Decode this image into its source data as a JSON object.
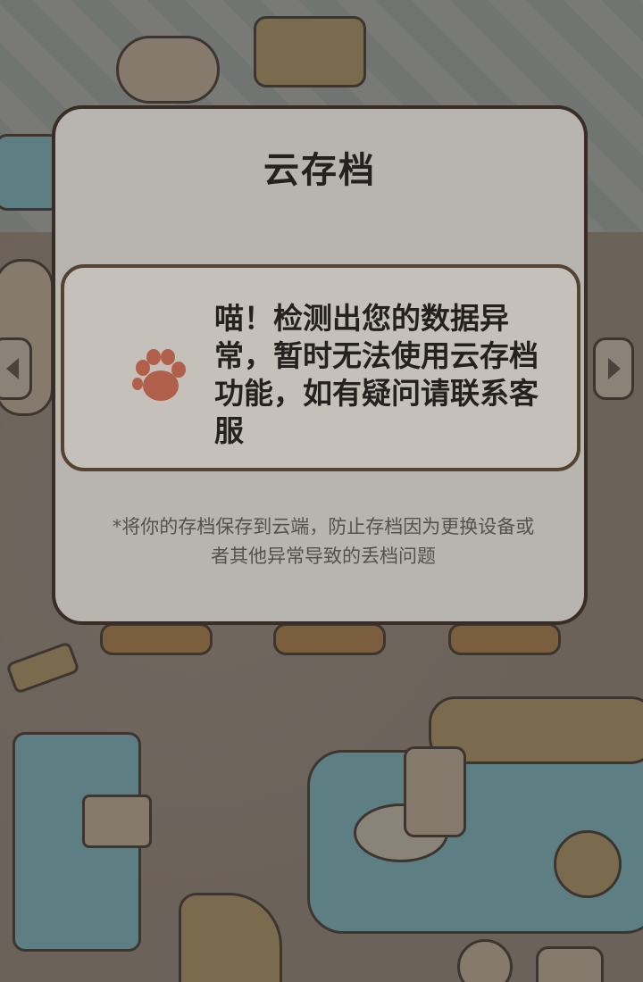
{
  "modal": {
    "title": "云存档",
    "message": "喵！检测出您的数据异常，暂时无法使用云存档功能，如有疑问请联系客服",
    "footnote": "*将你的存档保存到云端，防止存档因为更换设备或者其他异常导致的丢档问题"
  },
  "icons": {
    "paw": "paw-print-icon",
    "left": "chevron-left-icon",
    "right": "chevron-right-icon"
  },
  "colors": {
    "overlay": "#6f665e",
    "modal_bg": "#ece8e2",
    "modal_border": "#4b3a30",
    "message_bg": "#fdf7ef",
    "paw": "#e07a5f"
  }
}
